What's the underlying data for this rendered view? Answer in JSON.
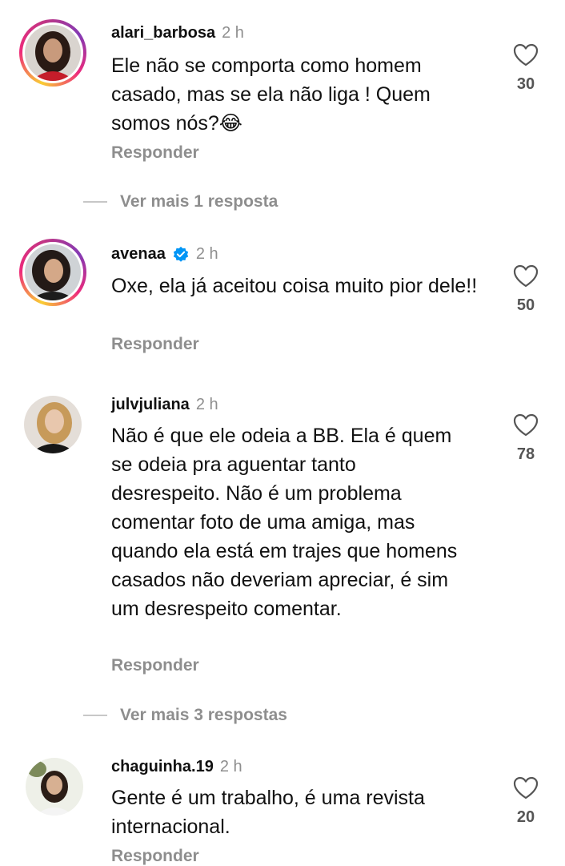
{
  "comments": [
    {
      "username": "alari_barbosa",
      "time": "2 h",
      "text": "Ele não se comporta como homem casado, mas se ela não liga ! Quem somos nós?😂",
      "likes": "30",
      "reply_label": "Responder"
    },
    {
      "username": "avenaa",
      "time": "2 h",
      "verified": true,
      "text": "Oxe, ela já aceitou coisa muito pior dele!!",
      "likes": "50",
      "reply_label": "Responder"
    },
    {
      "username": "julvjuliana",
      "time": "2 h",
      "text": "Não é que ele odeia a BB. Ela é quem se odeia pra aguentar tanto desrespeito. Não é um problema comentar foto de uma amiga, mas quando ela está em trajes que homens casados não deveriam apreciar, é sim um desrespeito comentar.",
      "likes": "78",
      "reply_label": "Responder"
    },
    {
      "username": "chaguinha.19",
      "time": "2 h",
      "text": "Gente é um trabalho, é uma revista internacional.",
      "likes": "20",
      "reply_label": "Responder"
    }
  ],
  "more_replies": [
    "Ver mais 1 resposta",
    "Ver mais 3 respostas"
  ],
  "icons": {
    "like": "heart-outline-icon",
    "verified": "verified-badge-icon"
  },
  "colors": {
    "secondary_text": "#8e8e8e",
    "verified_blue": "#0095f6"
  }
}
